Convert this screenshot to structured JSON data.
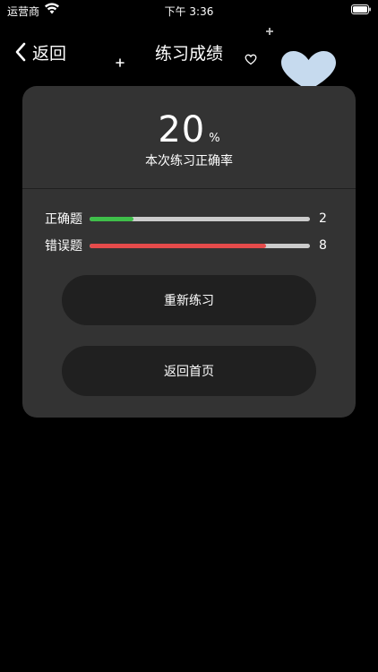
{
  "status_bar": {
    "carrier": "运营商",
    "time": "下午 3:36",
    "wifi_icon": "wifi-icon",
    "battery_icon": "battery-icon"
  },
  "nav": {
    "back_label": "返回",
    "back_icon": "chevron-left-icon",
    "title": "练习成绩"
  },
  "result": {
    "score": "20",
    "unit": "%",
    "caption": "本次练习正确率"
  },
  "stats": {
    "correct": {
      "label": "正确题",
      "count": "2",
      "fraction": 0.2,
      "color": "#3fbf4a"
    },
    "wrong": {
      "label": "错误题",
      "count": "8",
      "fraction": 0.8,
      "color": "#e54b4b"
    },
    "track_color": "#cccccc"
  },
  "actions": {
    "retry_label": "重新练习",
    "home_label": "返回首页"
  },
  "colors": {
    "background": "#000000",
    "card": "#333333",
    "button": "#202020",
    "heart": "#c6daee"
  }
}
